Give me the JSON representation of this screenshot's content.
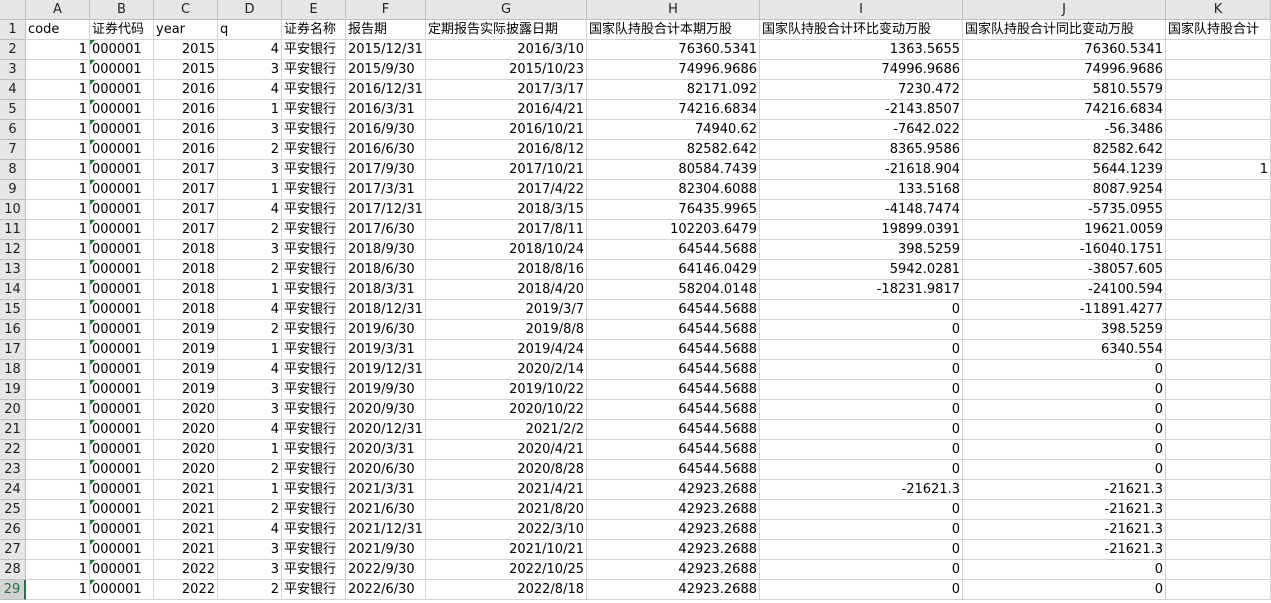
{
  "columns": [
    "A",
    "B",
    "C",
    "D",
    "E",
    "F",
    "G",
    "H",
    "I",
    "J",
    "K"
  ],
  "headers": [
    "code",
    "证券代码",
    "year",
    "q",
    "证券名称",
    "报告期",
    "定期报告实际披露日期",
    "国家队持股合计本期万股",
    "国家队持股合计环比变动万股",
    "国家队持股合计同比变动万股",
    "国家队持股合计"
  ],
  "rows": [
    [
      "1",
      "000001",
      "2015",
      "4",
      "平安银行",
      "2015/12/31",
      "2016/3/10",
      "76360.5341",
      "1363.5655",
      "76360.5341",
      ""
    ],
    [
      "1",
      "000001",
      "2015",
      "3",
      "平安银行",
      "2015/9/30",
      "2015/10/23",
      "74996.9686",
      "74996.9686",
      "74996.9686",
      ""
    ],
    [
      "1",
      "000001",
      "2016",
      "4",
      "平安银行",
      "2016/12/31",
      "2017/3/17",
      "82171.092",
      "7230.472",
      "5810.5579",
      ""
    ],
    [
      "1",
      "000001",
      "2016",
      "1",
      "平安银行",
      "2016/3/31",
      "2016/4/21",
      "74216.6834",
      "-2143.8507",
      "74216.6834",
      ""
    ],
    [
      "1",
      "000001",
      "2016",
      "3",
      "平安银行",
      "2016/9/30",
      "2016/10/21",
      "74940.62",
      "-7642.022",
      "-56.3486",
      ""
    ],
    [
      "1",
      "000001",
      "2016",
      "2",
      "平安银行",
      "2016/6/30",
      "2016/8/12",
      "82582.642",
      "8365.9586",
      "82582.642",
      ""
    ],
    [
      "1",
      "000001",
      "2017",
      "3",
      "平安银行",
      "2017/9/30",
      "2017/10/21",
      "80584.7439",
      "-21618.904",
      "5644.1239",
      "1"
    ],
    [
      "1",
      "000001",
      "2017",
      "1",
      "平安银行",
      "2017/3/31",
      "2017/4/22",
      "82304.6088",
      "133.5168",
      "8087.9254",
      ""
    ],
    [
      "1",
      "000001",
      "2017",
      "4",
      "平安银行",
      "2017/12/31",
      "2018/3/15",
      "76435.9965",
      "-4148.7474",
      "-5735.0955",
      ""
    ],
    [
      "1",
      "000001",
      "2017",
      "2",
      "平安银行",
      "2017/6/30",
      "2017/8/11",
      "102203.6479",
      "19899.0391",
      "19621.0059",
      ""
    ],
    [
      "1",
      "000001",
      "2018",
      "3",
      "平安银行",
      "2018/9/30",
      "2018/10/24",
      "64544.5688",
      "398.5259",
      "-16040.1751",
      ""
    ],
    [
      "1",
      "000001",
      "2018",
      "2",
      "平安银行",
      "2018/6/30",
      "2018/8/16",
      "64146.0429",
      "5942.0281",
      "-38057.605",
      ""
    ],
    [
      "1",
      "000001",
      "2018",
      "1",
      "平安银行",
      "2018/3/31",
      "2018/4/20",
      "58204.0148",
      "-18231.9817",
      "-24100.594",
      ""
    ],
    [
      "1",
      "000001",
      "2018",
      "4",
      "平安银行",
      "2018/12/31",
      "2019/3/7",
      "64544.5688",
      "0",
      "-11891.4277",
      ""
    ],
    [
      "1",
      "000001",
      "2019",
      "2",
      "平安银行",
      "2019/6/30",
      "2019/8/8",
      "64544.5688",
      "0",
      "398.5259",
      ""
    ],
    [
      "1",
      "000001",
      "2019",
      "1",
      "平安银行",
      "2019/3/31",
      "2019/4/24",
      "64544.5688",
      "0",
      "6340.554",
      ""
    ],
    [
      "1",
      "000001",
      "2019",
      "4",
      "平安银行",
      "2019/12/31",
      "2020/2/14",
      "64544.5688",
      "0",
      "0",
      ""
    ],
    [
      "1",
      "000001",
      "2019",
      "3",
      "平安银行",
      "2019/9/30",
      "2019/10/22",
      "64544.5688",
      "0",
      "0",
      ""
    ],
    [
      "1",
      "000001",
      "2020",
      "3",
      "平安银行",
      "2020/9/30",
      "2020/10/22",
      "64544.5688",
      "0",
      "0",
      ""
    ],
    [
      "1",
      "000001",
      "2020",
      "4",
      "平安银行",
      "2020/12/31",
      "2021/2/2",
      "64544.5688",
      "0",
      "0",
      ""
    ],
    [
      "1",
      "000001",
      "2020",
      "1",
      "平安银行",
      "2020/3/31",
      "2020/4/21",
      "64544.5688",
      "0",
      "0",
      ""
    ],
    [
      "1",
      "000001",
      "2020",
      "2",
      "平安银行",
      "2020/6/30",
      "2020/8/28",
      "64544.5688",
      "0",
      "0",
      ""
    ],
    [
      "1",
      "000001",
      "2021",
      "1",
      "平安银行",
      "2021/3/31",
      "2021/4/21",
      "42923.2688",
      "-21621.3",
      "-21621.3",
      ""
    ],
    [
      "1",
      "000001",
      "2021",
      "2",
      "平安银行",
      "2021/6/30",
      "2021/8/20",
      "42923.2688",
      "0",
      "-21621.3",
      ""
    ],
    [
      "1",
      "000001",
      "2021",
      "4",
      "平安银行",
      "2021/12/31",
      "2022/3/10",
      "42923.2688",
      "0",
      "-21621.3",
      ""
    ],
    [
      "1",
      "000001",
      "2021",
      "3",
      "平安银行",
      "2021/9/30",
      "2021/10/21",
      "42923.2688",
      "0",
      "-21621.3",
      ""
    ],
    [
      "1",
      "000001",
      "2022",
      "3",
      "平安银行",
      "2022/9/30",
      "2022/10/25",
      "42923.2688",
      "0",
      "0",
      ""
    ],
    [
      "1",
      "000001",
      "2022",
      "2",
      "平安银行",
      "2022/6/30",
      "2022/8/18",
      "42923.2688",
      "0",
      "0",
      ""
    ]
  ],
  "active_row": 29,
  "colors": {
    "header_bg": "#e6e6e6",
    "gridline": "#d4d4d4",
    "accent": "#217346"
  }
}
